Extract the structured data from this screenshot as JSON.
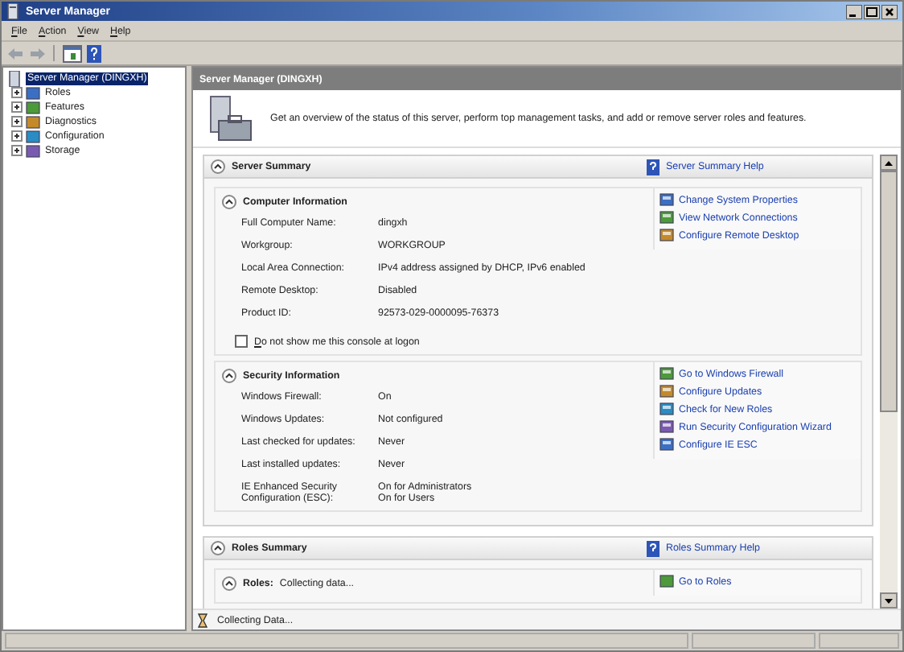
{
  "window": {
    "title": "Server Manager"
  },
  "menu": [
    {
      "label": "File"
    },
    {
      "label": "Action"
    },
    {
      "label": "View"
    },
    {
      "label": "Help"
    }
  ],
  "tree": {
    "root": {
      "label": "Server Manager (DINGXH)",
      "selected": true
    },
    "children": [
      {
        "label": "Roles",
        "expanded": false,
        "selected": false
      },
      {
        "label": "Features",
        "expanded": false,
        "selected": false
      },
      {
        "label": "Diagnostics",
        "expanded": false,
        "selected": false
      },
      {
        "label": "Configuration",
        "expanded": false,
        "selected": false
      },
      {
        "label": "Storage",
        "expanded": false,
        "selected": false
      }
    ]
  },
  "header": {
    "title": "Server Manager (DINGXH)"
  },
  "intro": "Get an overview of the status of this server, perform top management tasks, and add or remove server roles and features.",
  "server_summary": {
    "title": "Server Summary",
    "expanded": true,
    "help_link": "Server Summary Help",
    "sections": [
      {
        "title": "Computer Information",
        "expanded": true,
        "rows": [
          {
            "label": "Full Computer Name:",
            "values": [
              "dingxh"
            ]
          },
          {
            "label": "Workgroup:",
            "values": [
              "WORKGROUP"
            ]
          },
          {
            "label": "Local Area Connection:",
            "values": [
              "IPv4 address assigned by DHCP, IPv6 enabled"
            ]
          },
          {
            "label": "Remote Desktop:",
            "values": [
              "Disabled"
            ]
          },
          {
            "label": "Product ID:",
            "values": [
              "92573-029-0000095-76373"
            ]
          }
        ],
        "checkbox": {
          "label": "Do not show me this console at logon",
          "checked": false
        },
        "links": [
          "Change System Properties",
          "View Network Connections",
          "Configure Remote Desktop"
        ]
      },
      {
        "title": "Security Information",
        "expanded": true,
        "rows": [
          {
            "label": "Windows Firewall:",
            "values": [
              "On"
            ]
          },
          {
            "label": "Windows Updates:",
            "values": [
              "Not configured"
            ]
          },
          {
            "label": "Last checked for updates:",
            "values": [
              "Never"
            ]
          },
          {
            "label": "Last installed updates:",
            "values": [
              "Never"
            ]
          },
          {
            "label": "IE Enhanced Security Configuration (ESC):",
            "values": [
              "On for Administrators",
              "On for Users"
            ]
          }
        ],
        "links": [
          "Go to Windows Firewall",
          "Configure Updates",
          "Check for New Roles",
          "Run Security Configuration Wizard",
          "Configure IE ESC"
        ]
      }
    ]
  },
  "roles_summary": {
    "title": "Roles Summary",
    "expanded": true,
    "help_link": "Roles Summary Help",
    "roles": {
      "title": "Roles:",
      "value": "Collecting data...",
      "expanded": true,
      "link": "Go to Roles"
    }
  },
  "loading": "Collecting Data..."
}
